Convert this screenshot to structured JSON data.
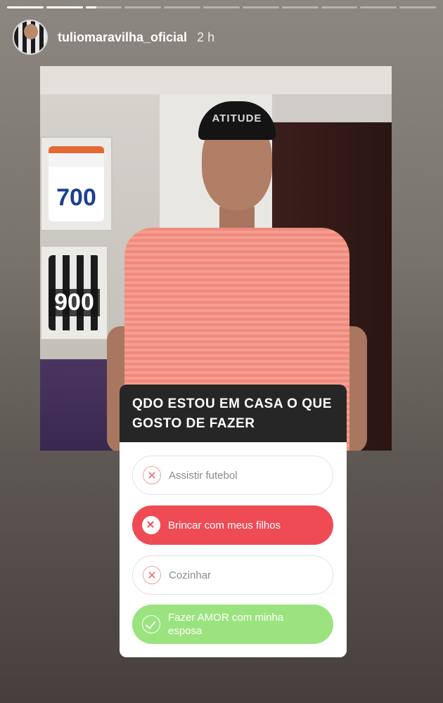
{
  "story": {
    "segments": 11,
    "progress": [
      1,
      1,
      0.3,
      0,
      0,
      0,
      0,
      0,
      0,
      0,
      0
    ],
    "username": "tuliomaravilha_oficial",
    "time": "2 h"
  },
  "photo": {
    "cap_text": "ATITUDE",
    "jersey_1_number": "700",
    "jersey_2_number": "900"
  },
  "poll": {
    "question": "QDO ESTOU EM CASA O QUE GOSTO DE FAZER",
    "options": [
      {
        "label": "Assistir futebol",
        "state": "wrong",
        "icon": "x-circle-icon"
      },
      {
        "label": "Brincar com meus filhos",
        "state": "selected-wrong",
        "icon": "x-circle-icon"
      },
      {
        "label": "Cozinhar",
        "state": "wrong",
        "icon": "x-circle-icon"
      },
      {
        "label": "Fazer AMOR com minha esposa",
        "state": "correct",
        "icon": "check-circle-icon"
      }
    ]
  },
  "colors": {
    "selected_wrong": "#ef4b55",
    "correct": "#9be37f",
    "poll_header": "#262626"
  }
}
